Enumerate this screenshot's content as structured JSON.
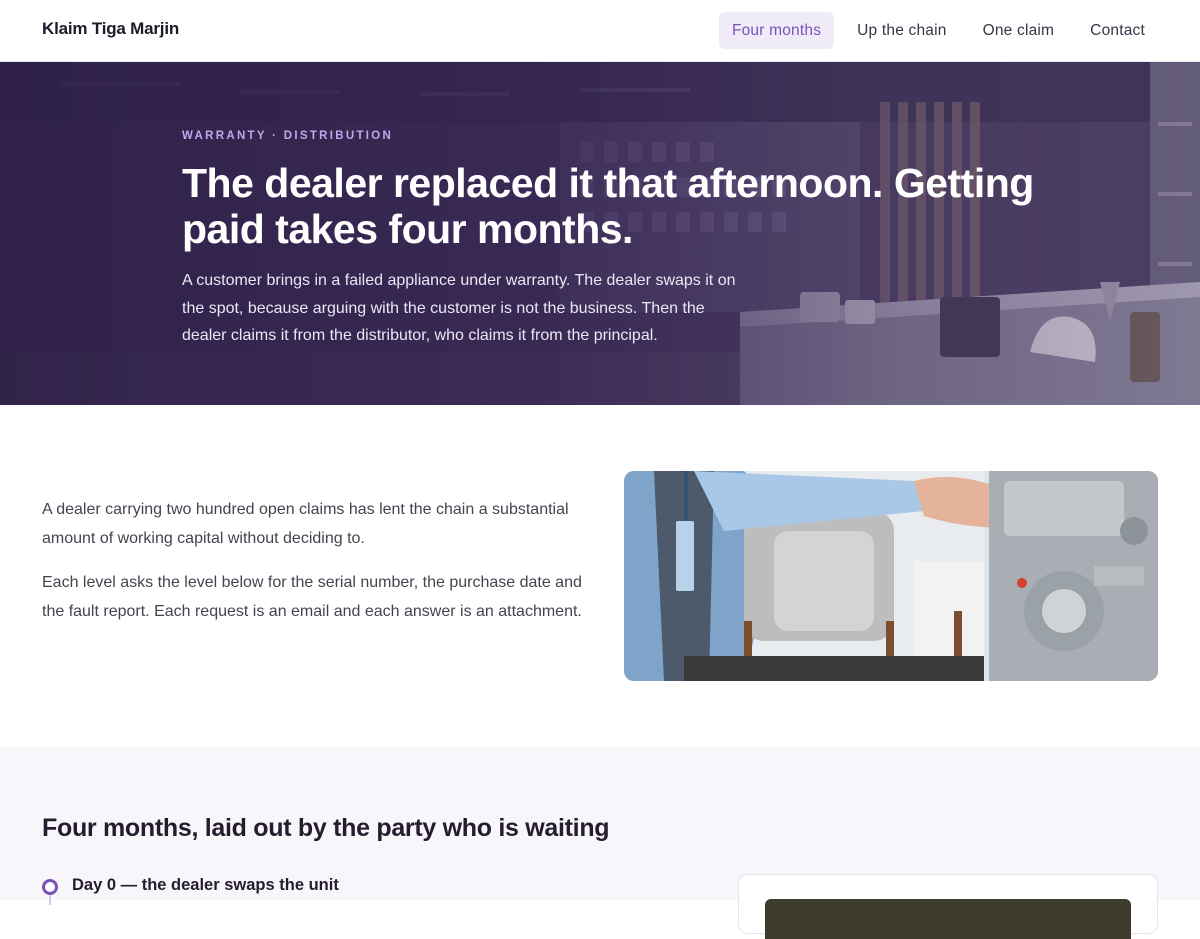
{
  "nav": {
    "brand": "Klaim Tiga Marjin",
    "links": [
      {
        "label": "Four months",
        "active": true
      },
      {
        "label": "Up the chain",
        "active": false
      },
      {
        "label": "One claim",
        "active": false
      },
      {
        "label": "Contact",
        "active": false
      }
    ]
  },
  "hero": {
    "eyebrow": "WARRANTY · DISTRIBUTION",
    "title": "The dealer replaced it that afternoon. Getting paid takes four months.",
    "lede": "A customer brings in a failed appliance under warranty. The dealer swaps it on the spot, because arguing with the customer is not the business. Then the dealer claims it from the distributor, who claims it from the principal."
  },
  "intro": {
    "paragraphs": [
      "A dealer carrying two hundred open claims has lent the chain a substantial amount of working capital without deciding to.",
      "Each level asks the level below for the serial number, the purchase date and the fault report. Each request is an email and each answer is an attachment."
    ]
  },
  "timeline": {
    "heading": "Four months, laid out by the party who is waiting",
    "items": [
      {
        "title": "Day 0 — the dealer swaps the unit"
      }
    ]
  },
  "colors": {
    "accent": "#7a52b6",
    "accent_bg": "#f0ebf8",
    "hero_overlay": "#2f2547",
    "eyebrow": "#c4a6ee"
  }
}
